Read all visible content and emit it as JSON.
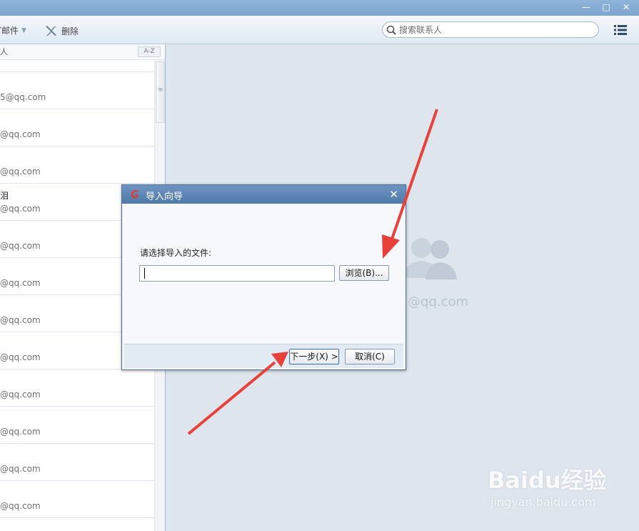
{
  "toolbar": {
    "write_label": "写邮件",
    "delete_label": "删除",
    "search_placeholder": "搜索联系人"
  },
  "list": {
    "header_label": "人",
    "sort_label": "A-Z",
    "rows": [
      {
        "name": "",
        "email": "5@qq.com"
      },
      {
        "name": "",
        "email": "@qq.com"
      },
      {
        "name": "",
        "email": "@qq.com"
      },
      {
        "name": "泪",
        "email": "@qq.com"
      },
      {
        "name": "",
        "email": "@qq.com"
      },
      {
        "name": "",
        "email": "@qq.com"
      },
      {
        "name": "",
        "email": "@qq.com"
      },
      {
        "name": "",
        "email": "@qq.com"
      },
      {
        "name": "",
        "email": "@qq.com"
      },
      {
        "name": "",
        "email": "@qq.com"
      },
      {
        "name": "",
        "email": "@qq.com"
      },
      {
        "name": "",
        "email": "@qq.com"
      }
    ]
  },
  "detail": {
    "email": "@qq.com"
  },
  "dialog": {
    "title": "导入向导",
    "prompt": "请选择导入的文件:",
    "file_value": "",
    "browse_label": "浏览(B)...",
    "next_label": "下一步(X) >",
    "cancel_label": "取消(C)"
  },
  "watermark": {
    "brand": "Baidu",
    "brand_cn": "经验",
    "url": "jingyan.baidu.com"
  },
  "colors": {
    "accent": "#4f79aa",
    "arrow": "#e8413c"
  }
}
